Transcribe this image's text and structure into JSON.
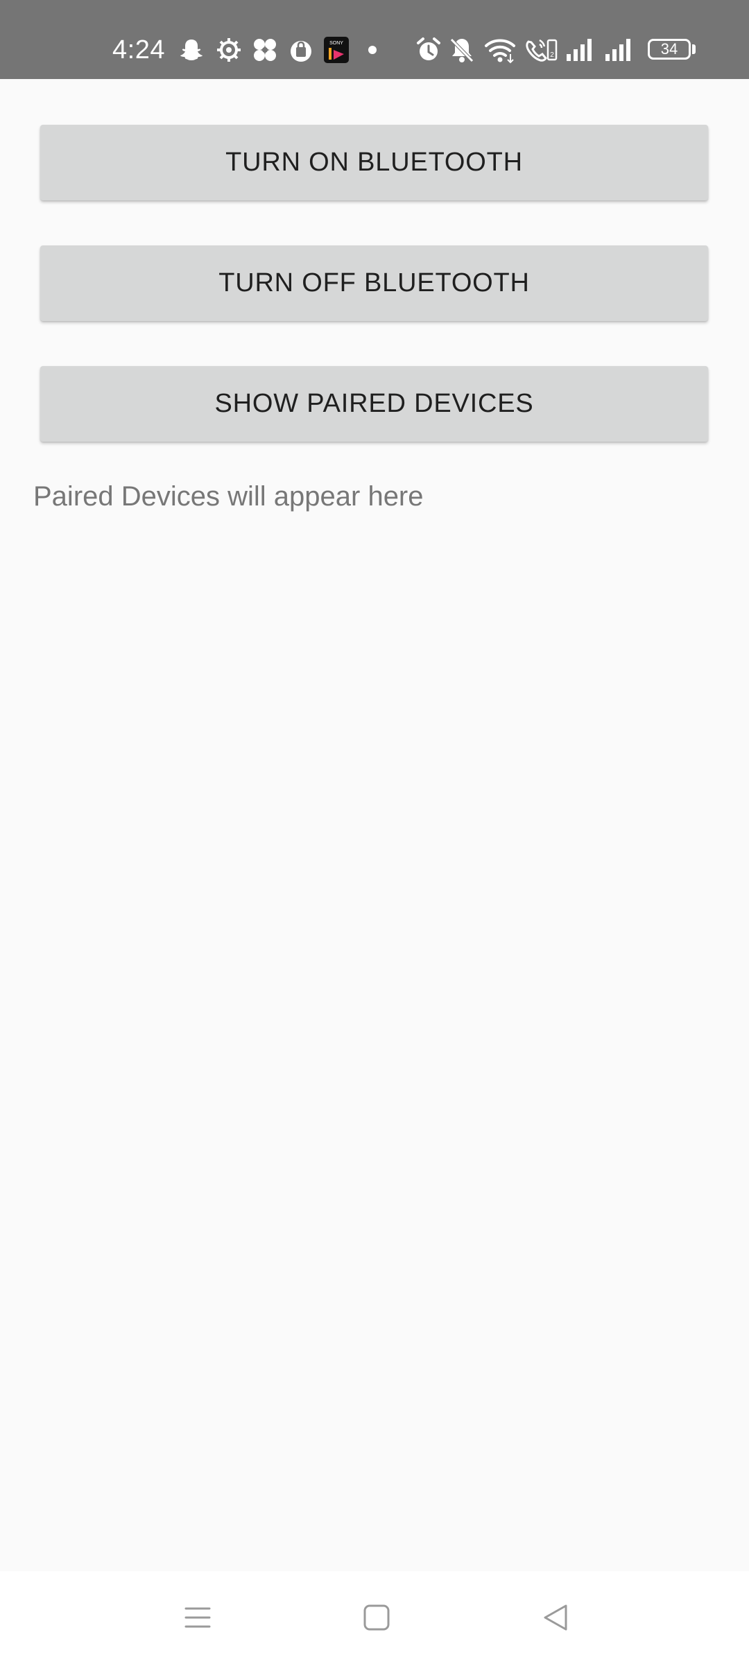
{
  "status_bar": {
    "time": "4:24",
    "battery_level": "34",
    "notification_icons": [
      "snapchat-icon",
      "settings-gear-icon",
      "pinwheel-icon",
      "shopping-bag-icon",
      "sonyliv-app-icon",
      "dot-icon"
    ],
    "system_icons": [
      "alarm-icon",
      "bell-muted-icon",
      "wifi-icon",
      "volte-call-icon",
      "signal-icon",
      "signal-icon",
      "battery-icon"
    ]
  },
  "buttons": {
    "turn_on": "TURN ON BLUETOOTH",
    "turn_off": "TURN OFF BLUETOOTH",
    "show_paired": "SHOW PAIRED DEVICES"
  },
  "paired_devices_text": "Paired Devices will appear here",
  "nav_bar": {
    "icons": [
      "menu-icon",
      "home-icon",
      "back-icon"
    ]
  },
  "colors": {
    "status_bar_bg": "#757575",
    "button_bg": "#d6d7d7",
    "page_bg": "#fafafa",
    "secondary_text": "#777777"
  }
}
